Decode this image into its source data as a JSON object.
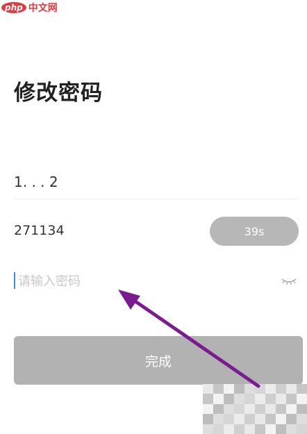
{
  "watermark": {
    "badge": "php",
    "site": "中文网"
  },
  "page": {
    "title": "修改密码"
  },
  "phone": {
    "value": "1.          . . 2"
  },
  "code": {
    "value": "271134",
    "countdown": "39s"
  },
  "password": {
    "placeholder": "请输入密码",
    "value": ""
  },
  "actions": {
    "done_label": "完成"
  },
  "annotation": {
    "arrow_color": "#7a1b8f"
  },
  "icons": {
    "visibility": "eye-closed-icon"
  },
  "colors": {
    "button_disabled": "#b2b2b2",
    "countdown_bg": "#b7b7b7",
    "cursor": "#3a8ee6",
    "watermark_red": "#e4393c"
  }
}
